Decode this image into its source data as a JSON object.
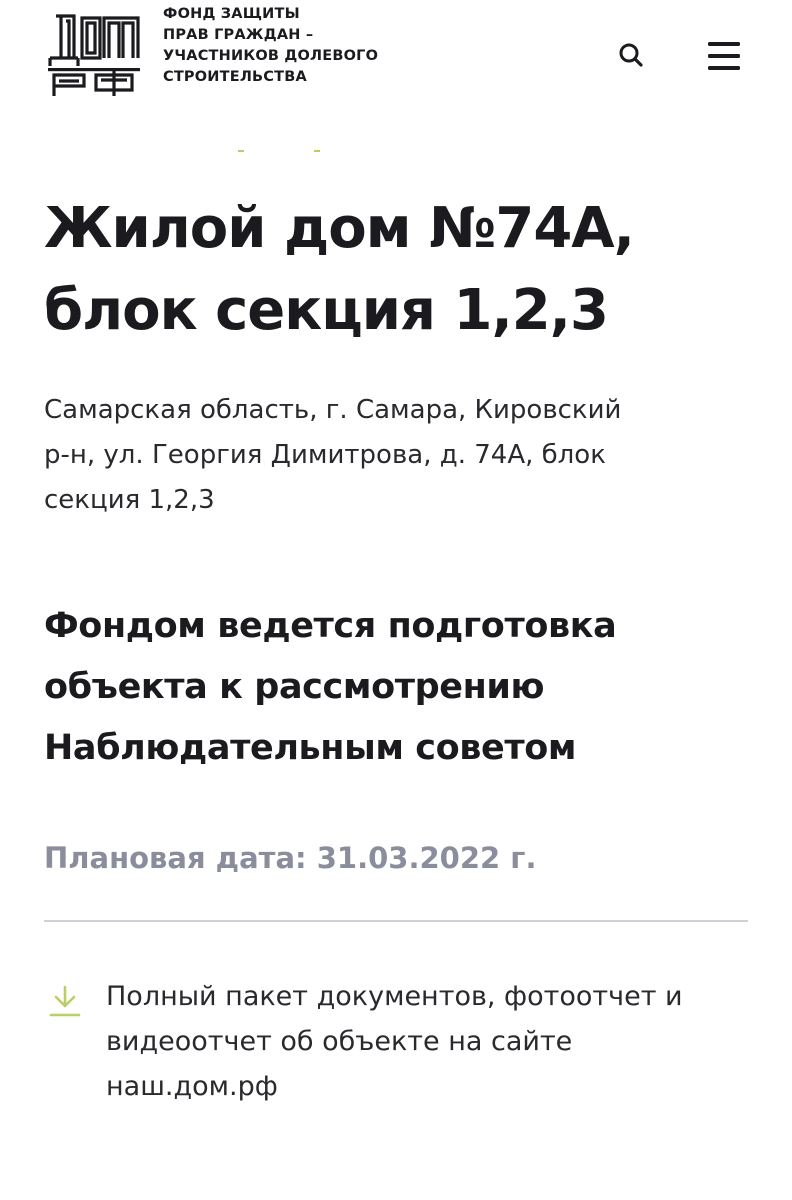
{
  "header": {
    "fund_name_lines": [
      "ФОНД ЗАЩИТЫ",
      "ПРАВ ГРАЖДАН –",
      "УЧАСТНИКОВ ДОЛЕВОГО",
      "СТРОИТЕЛЬСТВА"
    ],
    "logo_text_top": "ДОМ",
    "logo_text_bottom": "РФ",
    "search_icon": "search-icon",
    "menu_icon": "hamburger-menu-icon"
  },
  "object": {
    "title_lines": [
      "Жилой дом №74А,",
      "блок секция 1,2,3"
    ],
    "address_lines": [
      "Самарская область, г. Самара, Кировский",
      "р-н, ул. Георгия Димитрова, д. 74А, блок",
      "секция 1,2,3"
    ]
  },
  "status": {
    "lines": [
      "Фондом ведется подготовка",
      "объекта к рассмотрению",
      "Наблюдательным советом"
    ]
  },
  "planned_date": {
    "text": "Плановая дата: 31.03.2022 г."
  },
  "documents_link": {
    "icon": "download-icon",
    "lines": [
      "Полный пакет документов, фотоотчет и",
      "видеоотчет об объекте на сайте",
      "наш.дом.рф"
    ]
  },
  "colors": {
    "text": "#1b1b1f",
    "muted": "#8a8d9b",
    "divider": "#cfd1d8",
    "accent_green": "#b7cf67"
  }
}
